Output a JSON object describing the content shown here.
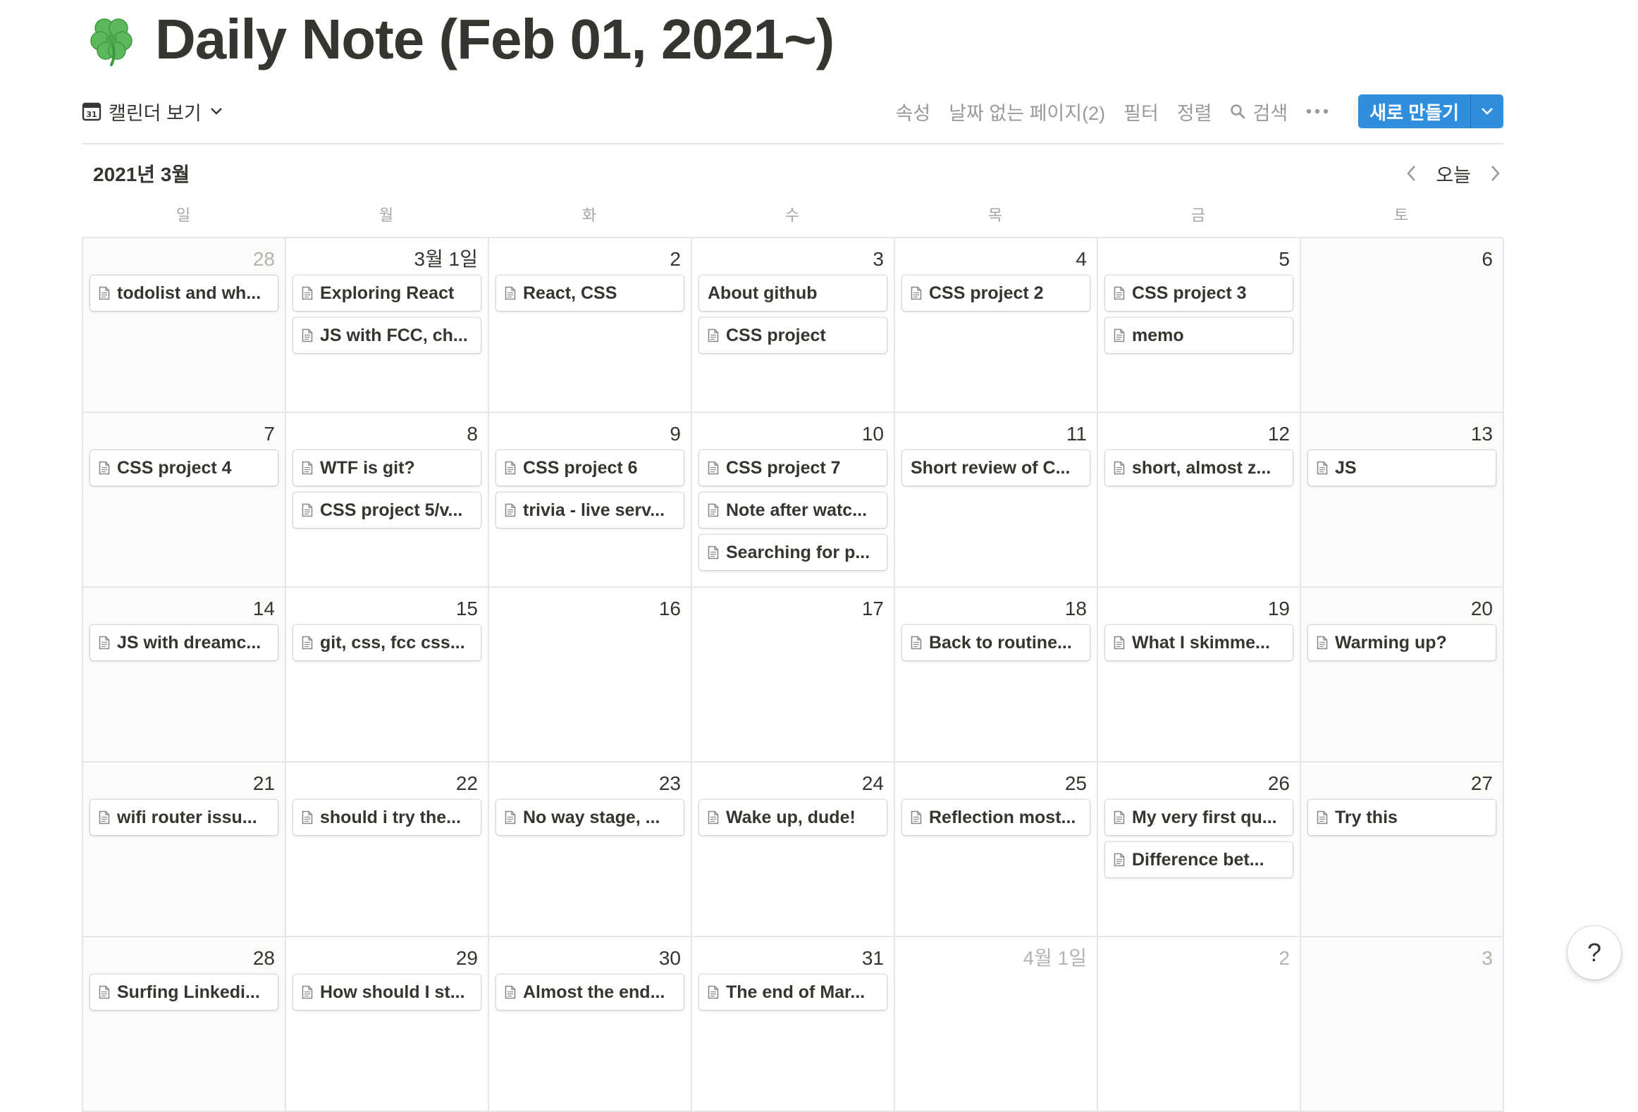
{
  "page": {
    "title": "Daily Note (Feb 01, 2021~)",
    "icon": "clover-icon"
  },
  "toolbar": {
    "view_label": "캘린더 보기",
    "properties": "속성",
    "no_date_pages": "날짜 없는 페이지(2)",
    "filter": "필터",
    "sort": "정렬",
    "search": "검색",
    "new_button": "새로 만들기",
    "accent_color": "#2f8fde"
  },
  "calendar": {
    "month_title": "2021년 3월",
    "today_label": "오늘",
    "weekdays": [
      "일",
      "월",
      "화",
      "수",
      "목",
      "금",
      "토"
    ],
    "weeks": [
      {
        "days": [
          {
            "label": "28",
            "muted": true,
            "weekend": true,
            "cards": [
              {
                "title": "todolist and wh...",
                "icon": true
              }
            ]
          },
          {
            "label": "3월 1일",
            "cards": [
              {
                "title": "Exploring React",
                "icon": true
              },
              {
                "title": "JS with FCC, ch...",
                "icon": true
              }
            ]
          },
          {
            "label": "2",
            "cards": [
              {
                "title": "React, CSS",
                "icon": true
              }
            ]
          },
          {
            "label": "3",
            "cards": [
              {
                "title": "About github",
                "icon": false
              },
              {
                "title": "CSS project",
                "icon": true
              }
            ]
          },
          {
            "label": "4",
            "cards": [
              {
                "title": "CSS project 2",
                "icon": true
              }
            ]
          },
          {
            "label": "5",
            "cards": [
              {
                "title": "CSS project 3",
                "icon": true
              },
              {
                "title": "memo",
                "icon": true
              }
            ]
          },
          {
            "label": "6",
            "weekend": true,
            "cards": []
          }
        ]
      },
      {
        "days": [
          {
            "label": "7",
            "weekend": true,
            "cards": [
              {
                "title": "CSS project 4",
                "icon": true
              }
            ]
          },
          {
            "label": "8",
            "cards": [
              {
                "title": "WTF is git?",
                "icon": true
              },
              {
                "title": "CSS project 5/v...",
                "icon": true
              }
            ]
          },
          {
            "label": "9",
            "cards": [
              {
                "title": "CSS project 6",
                "icon": true
              },
              {
                "title": "trivia - live serv...",
                "icon": true
              }
            ]
          },
          {
            "label": "10",
            "cards": [
              {
                "title": "CSS project 7",
                "icon": true
              },
              {
                "title": "Note after watc...",
                "icon": true
              },
              {
                "title": "Searching for p...",
                "icon": true
              }
            ]
          },
          {
            "label": "11",
            "cards": [
              {
                "title": "Short review of C...",
                "icon": false
              }
            ]
          },
          {
            "label": "12",
            "cards": [
              {
                "title": "short, almost z...",
                "icon": true
              }
            ]
          },
          {
            "label": "13",
            "weekend": true,
            "cards": [
              {
                "title": "JS",
                "icon": true
              }
            ]
          }
        ]
      },
      {
        "days": [
          {
            "label": "14",
            "weekend": true,
            "cards": [
              {
                "title": "JS with dreamc...",
                "icon": true
              }
            ]
          },
          {
            "label": "15",
            "cards": [
              {
                "title": "git, css, fcc css...",
                "icon": true
              }
            ]
          },
          {
            "label": "16",
            "cards": []
          },
          {
            "label": "17",
            "cards": []
          },
          {
            "label": "18",
            "cards": [
              {
                "title": "Back to routine...",
                "icon": true
              }
            ]
          },
          {
            "label": "19",
            "cards": [
              {
                "title": "What I skimme...",
                "icon": true
              }
            ]
          },
          {
            "label": "20",
            "weekend": true,
            "cards": [
              {
                "title": "Warming up?",
                "icon": true
              }
            ]
          }
        ]
      },
      {
        "days": [
          {
            "label": "21",
            "weekend": true,
            "cards": [
              {
                "title": "wifi router issu...",
                "icon": true
              }
            ]
          },
          {
            "label": "22",
            "cards": [
              {
                "title": "should i try the...",
                "icon": true
              }
            ]
          },
          {
            "label": "23",
            "cards": [
              {
                "title": "No way stage, ...",
                "icon": true
              }
            ]
          },
          {
            "label": "24",
            "cards": [
              {
                "title": "Wake up, dude!",
                "icon": true
              }
            ]
          },
          {
            "label": "25",
            "cards": [
              {
                "title": "Reflection most...",
                "icon": true
              }
            ]
          },
          {
            "label": "26",
            "cards": [
              {
                "title": "My very first qu...",
                "icon": true
              },
              {
                "title": "Difference bet...",
                "icon": true
              }
            ]
          },
          {
            "label": "27",
            "weekend": true,
            "cards": [
              {
                "title": "Try this",
                "icon": true
              }
            ]
          }
        ]
      },
      {
        "days": [
          {
            "label": "28",
            "weekend": true,
            "cards": [
              {
                "title": "Surfing Linkedi...",
                "icon": true
              }
            ]
          },
          {
            "label": "29",
            "cards": [
              {
                "title": "How should I st...",
                "icon": true
              }
            ]
          },
          {
            "label": "30",
            "cards": [
              {
                "title": "Almost the end...",
                "icon": true
              }
            ]
          },
          {
            "label": "31",
            "cards": [
              {
                "title": "The end of Mar...",
                "icon": true
              }
            ]
          },
          {
            "label": "4월 1일",
            "muted": true,
            "cards": []
          },
          {
            "label": "2",
            "muted": true,
            "cards": []
          },
          {
            "label": "3",
            "muted": true,
            "weekend": true,
            "cards": []
          }
        ]
      }
    ]
  },
  "help": {
    "label": "?"
  }
}
